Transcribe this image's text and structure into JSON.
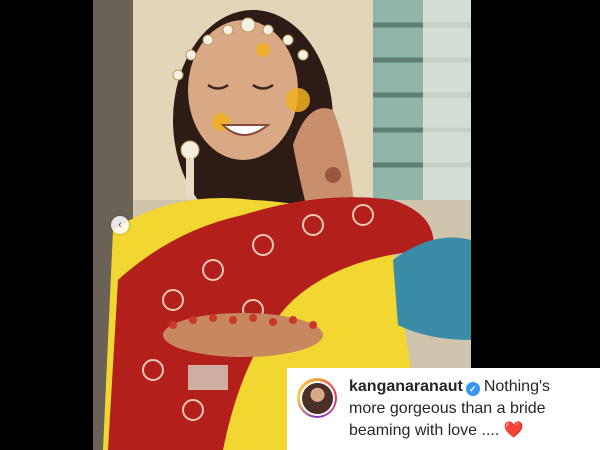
{
  "post": {
    "photo_icon": "photo",
    "carousel_prev_icon": "chevron-left-icon",
    "carousel_prev_glyph": "‹"
  },
  "comment": {
    "username": "kanganaranaut",
    "verified_icon": "verified-badge-icon",
    "verified_glyph": "✓",
    "text": "Nothing's more gorgeous than a bride beaming with love ....",
    "emoji": "❤️"
  },
  "colors": {
    "background": "#000000",
    "verified_blue": "#3897f0",
    "heart_red": "#ed1a3b",
    "saree_red": "#b3201c",
    "saree_yellow": "#f2d631"
  }
}
